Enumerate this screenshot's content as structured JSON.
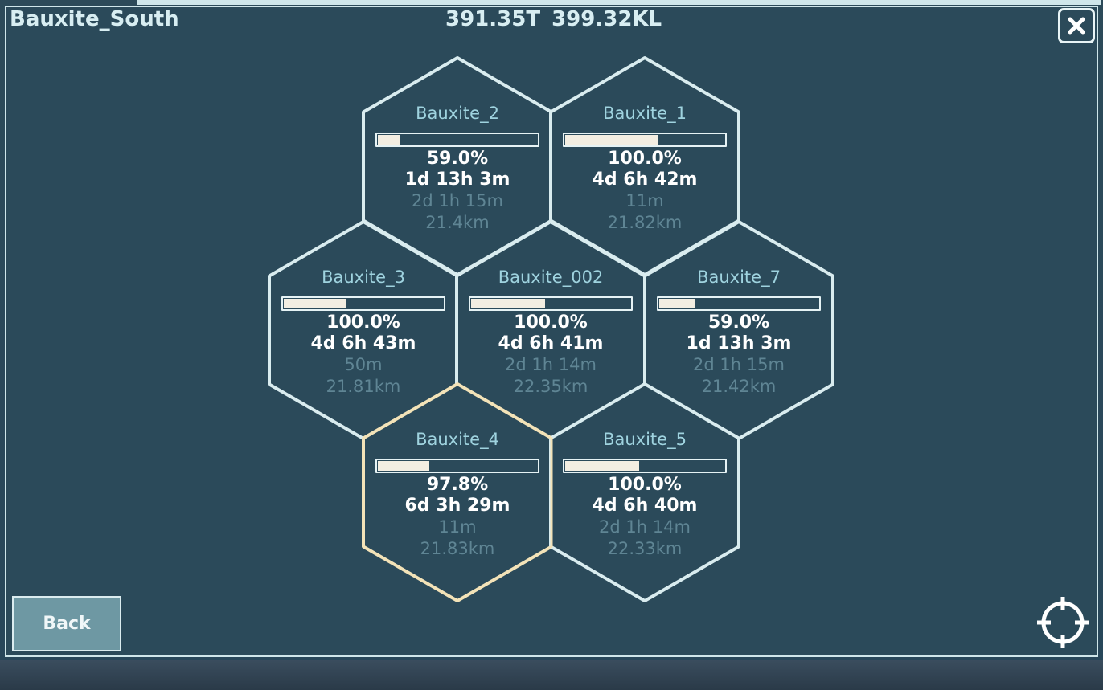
{
  "header": {
    "title": "Bauxite_South",
    "tons": "391.35T",
    "liquid": "399.32KL"
  },
  "buttons": {
    "back_label": "Back"
  },
  "icons": {
    "close": "close-icon",
    "locate": "crosshair-icon"
  },
  "colors": {
    "background": "#2b4a5a",
    "hex_border": "#d9ecef",
    "hex_selected_border": "#f3e3b8",
    "name_text": "#9fd3df",
    "dim_text": "#5f8594",
    "bar_fill": "#f3eee2"
  },
  "hexes": [
    {
      "name": "Bauxite_2",
      "progress": 0.15,
      "percent": "59.0%",
      "time_remaining": "1d 13h 3m",
      "secondary_time": "2d 1h 15m",
      "distance": "21.4km",
      "selected": false
    },
    {
      "name": "Bauxite_1",
      "progress": 0.59,
      "percent": "100.0%",
      "time_remaining": "4d 6h 42m",
      "secondary_time": "11m",
      "distance": "21.82km",
      "selected": false
    },
    {
      "name": "Bauxite_3",
      "progress": 0.4,
      "percent": "100.0%",
      "time_remaining": "4d 6h 43m",
      "secondary_time": "50m",
      "distance": "21.81km",
      "selected": false
    },
    {
      "name": "Bauxite_002",
      "progress": 0.47,
      "percent": "100.0%",
      "time_remaining": "4d 6h 41m",
      "secondary_time": "2d 1h 14m",
      "distance": "22.35km",
      "selected": false
    },
    {
      "name": "Bauxite_7",
      "progress": 0.23,
      "percent": "59.0%",
      "time_remaining": "1d 13h 3m",
      "secondary_time": "2d 1h 15m",
      "distance": "21.42km",
      "selected": false
    },
    {
      "name": "Bauxite_4",
      "progress": 0.33,
      "percent": "97.8%",
      "time_remaining": "6d 3h 29m",
      "secondary_time": "11m",
      "distance": "21.83km",
      "selected": true
    },
    {
      "name": "Bauxite_5",
      "progress": 0.47,
      "percent": "100.0%",
      "time_remaining": "4d 6h 40m",
      "secondary_time": "2d 1h 14m",
      "distance": "22.33km",
      "selected": false
    }
  ]
}
